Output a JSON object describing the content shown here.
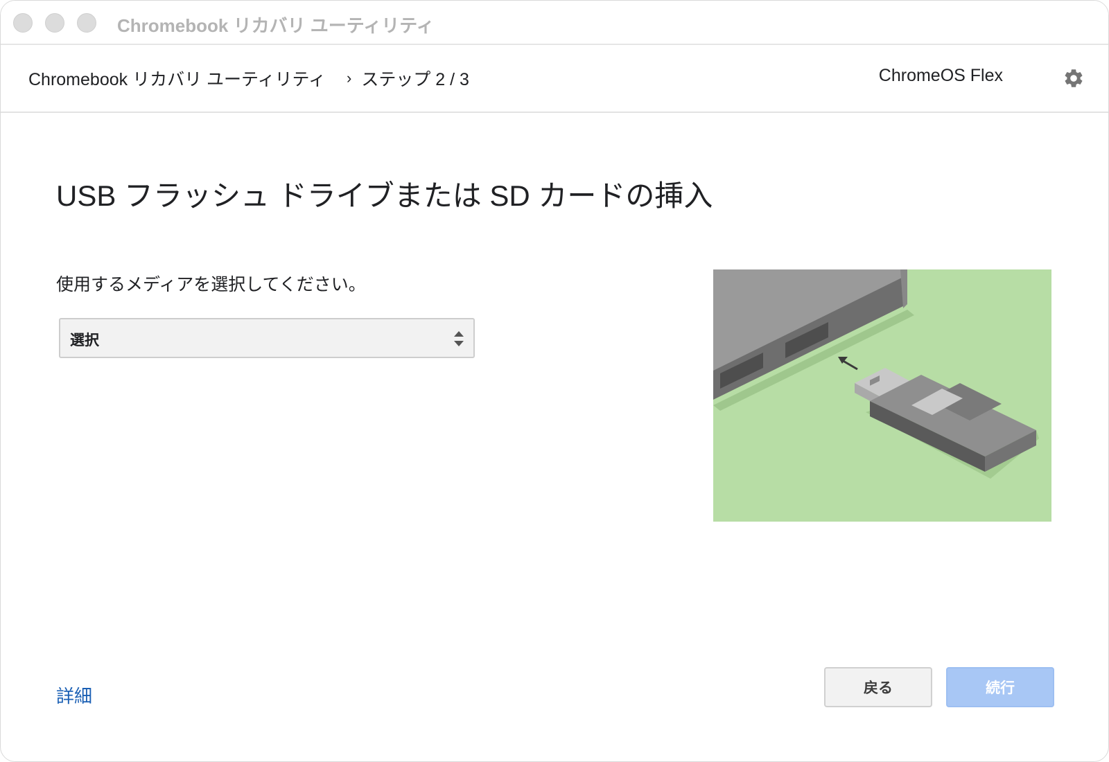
{
  "window": {
    "title": "Chromebook リカバリ ユーティリティ"
  },
  "header": {
    "breadcrumb_app": "Chromebook リカバリ ユーティリティ",
    "breadcrumb_separator": "›",
    "breadcrumb_step": "ステップ 2 / 3",
    "product": "ChromeOS Flex",
    "settings_icon": "gear-icon"
  },
  "main": {
    "heading": "USB フラッシュ ドライブまたは SD カードの挿入",
    "prompt": "使用するメディアを選択してください。",
    "media_select": {
      "selected": "選択"
    },
    "illustration": {
      "background_color": "#b7dda5",
      "subject": "usb-drive-insert"
    }
  },
  "footer": {
    "details_link": "詳細",
    "back_button": "戻る",
    "continue_button": "続行",
    "continue_enabled": false
  },
  "colors": {
    "link": "#1a5fb4",
    "primary_disabled": "#a8c7f5",
    "illustration_bg": "#b7dda5"
  }
}
